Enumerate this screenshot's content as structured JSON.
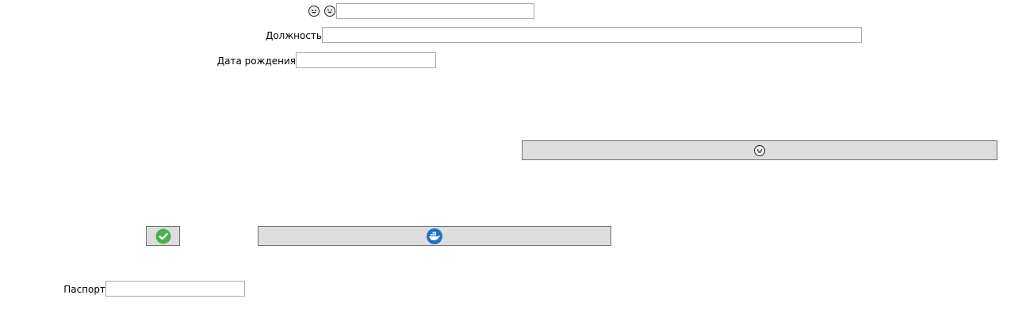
{
  "form": {
    "name_row": {
      "icons": [
        "laughing-face-icon",
        "grinning-face-icon"
      ],
      "value": "",
      "placeholder": ""
    },
    "position": {
      "label": "Должность",
      "value": "",
      "placeholder": ""
    },
    "birth_date": {
      "label": "Дата рождения",
      "value": "",
      "placeholder": ""
    },
    "passport": {
      "label": "Паспорт",
      "value": "",
      "placeholder": ""
    }
  },
  "buttons": {
    "emoji_action": {
      "icon": "laughing-face-icon"
    },
    "confirm": {
      "icon": "check-circle-icon",
      "color": "#4caf50"
    },
    "docker_action": {
      "icon": "docker-icon",
      "color": "#1d74c7"
    }
  }
}
